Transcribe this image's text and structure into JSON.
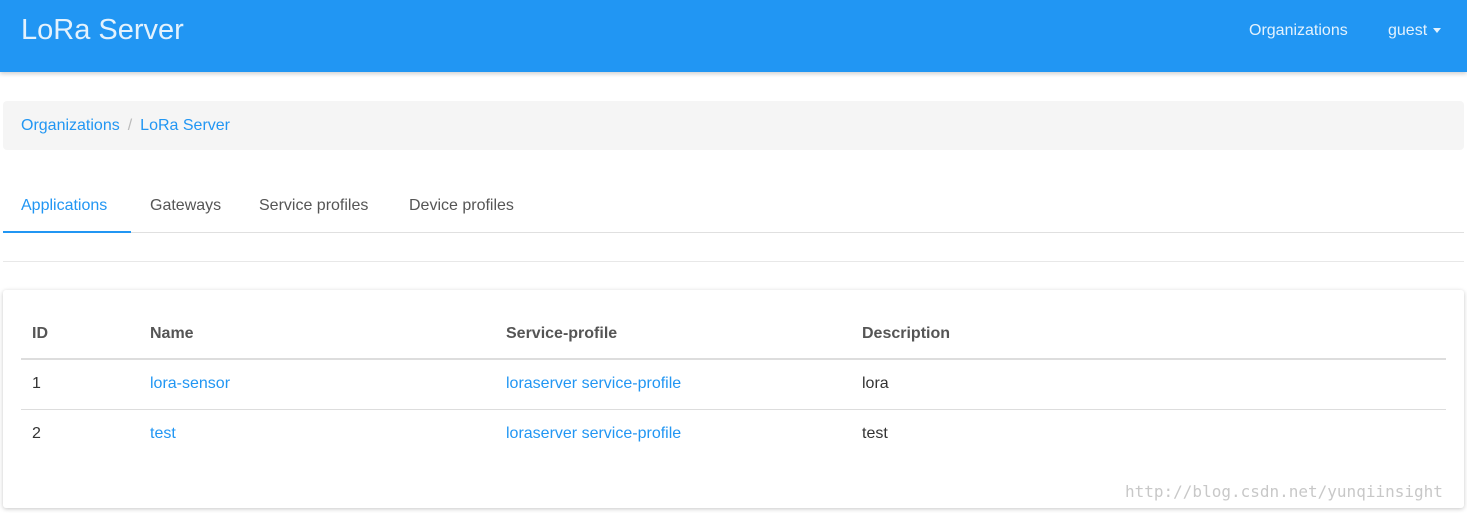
{
  "header": {
    "brand": "LoRa Server",
    "nav_organizations": "Organizations",
    "nav_user": "guest",
    "background_color": "#2196f3"
  },
  "breadcrumb": {
    "items": [
      "Organizations",
      "LoRa Server"
    ],
    "separator": "/"
  },
  "tabs": [
    {
      "label": "Applications",
      "active": true
    },
    {
      "label": "Gateways",
      "active": false
    },
    {
      "label": "Service profiles",
      "active": false
    },
    {
      "label": "Device profiles",
      "active": false
    }
  ],
  "table": {
    "columns": [
      "ID",
      "Name",
      "Service-profile",
      "Description"
    ],
    "rows": [
      {
        "id": "1",
        "name": "lora-sensor",
        "service_profile": "loraserver service-profile",
        "description": "lora"
      },
      {
        "id": "2",
        "name": "test",
        "service_profile": "loraserver service-profile",
        "description": "test"
      }
    ]
  },
  "watermark": "http://blog.csdn.net/yunqiinsight",
  "accent_color": "#2196f3"
}
